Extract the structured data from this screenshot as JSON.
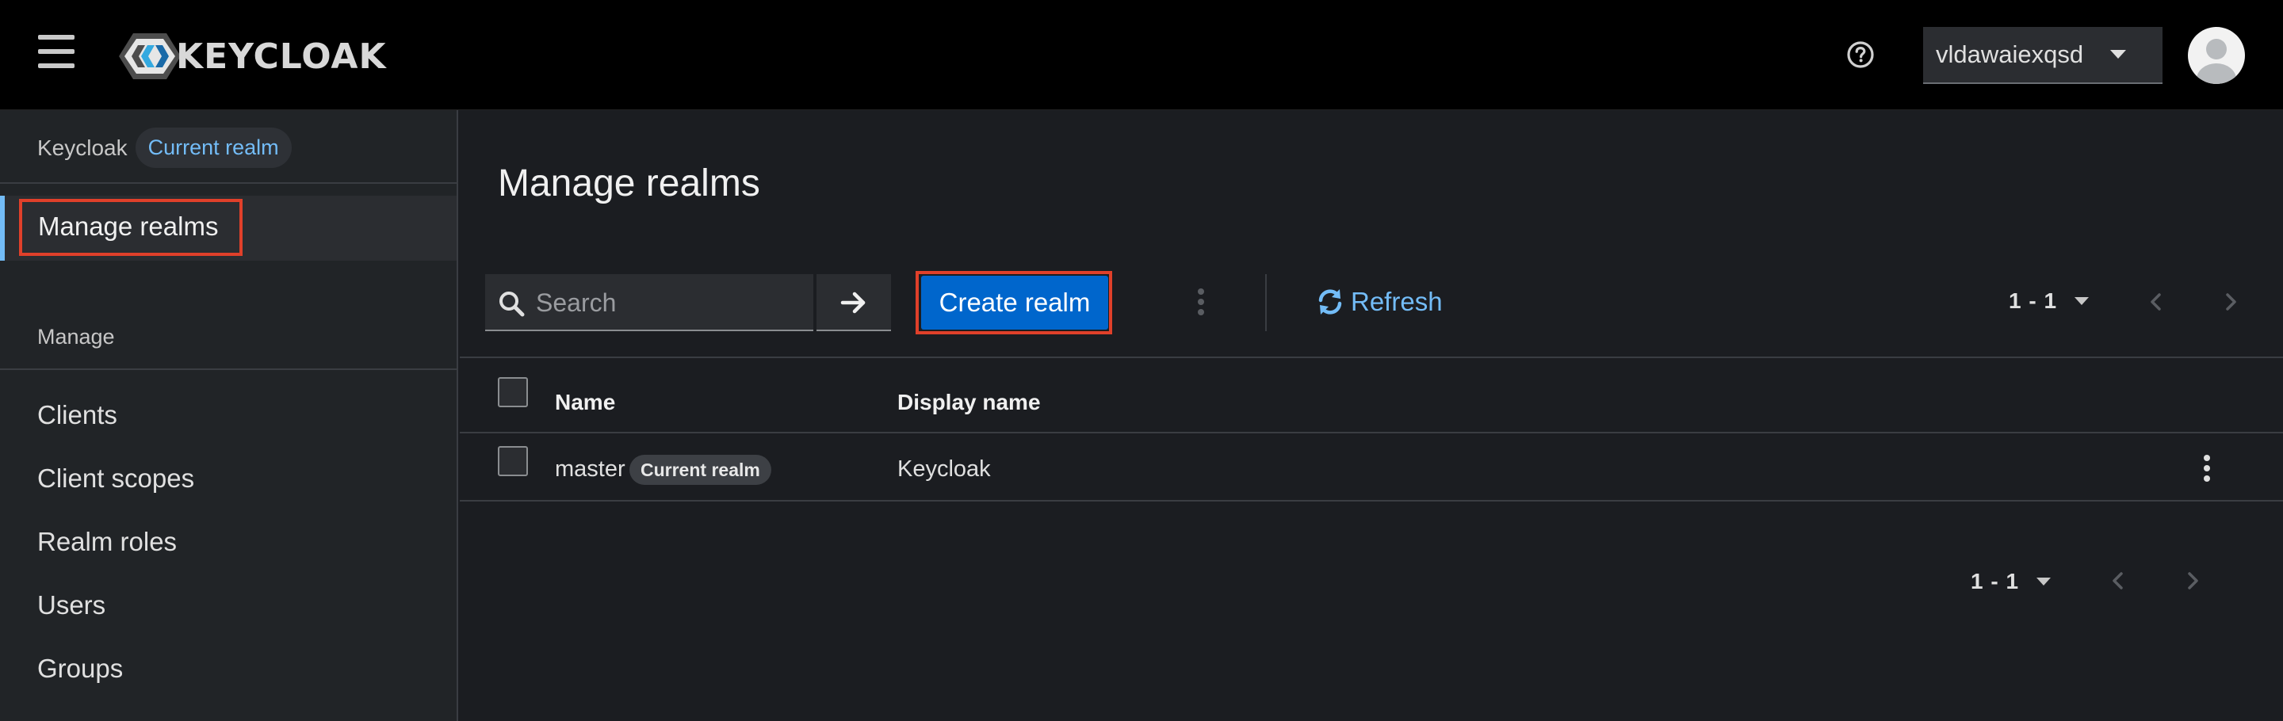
{
  "header": {
    "brand": "KEYCLOAK",
    "user": "vldawaiexqsd"
  },
  "sidebar": {
    "context_label": "Keycloak",
    "context_badge": "Current realm",
    "manage_realms": "Manage realms",
    "section_title": "Manage",
    "items": [
      "Clients",
      "Client scopes",
      "Realm roles",
      "Users",
      "Groups"
    ]
  },
  "main": {
    "title": "Manage realms",
    "search_placeholder": "Search",
    "create_button": "Create realm",
    "refresh": "Refresh",
    "pagination_top": "1 - 1",
    "pagination_bottom": "1 - 1",
    "columns": [
      "Name",
      "Display name"
    ],
    "rows": [
      {
        "name": "master",
        "badge": "Current realm",
        "display_name": "Keycloak"
      }
    ]
  },
  "colors": {
    "accent": "#73bcf7",
    "primary_button": "#0066cc",
    "highlight_box": "#e0402a"
  },
  "icons": [
    "hamburger-icon",
    "keycloak-logo-icon",
    "help-icon",
    "user-avatar-icon",
    "search-icon",
    "arrow-right-icon",
    "refresh-icon",
    "kebab-icon",
    "chevron-left-icon",
    "chevron-right-icon"
  ]
}
